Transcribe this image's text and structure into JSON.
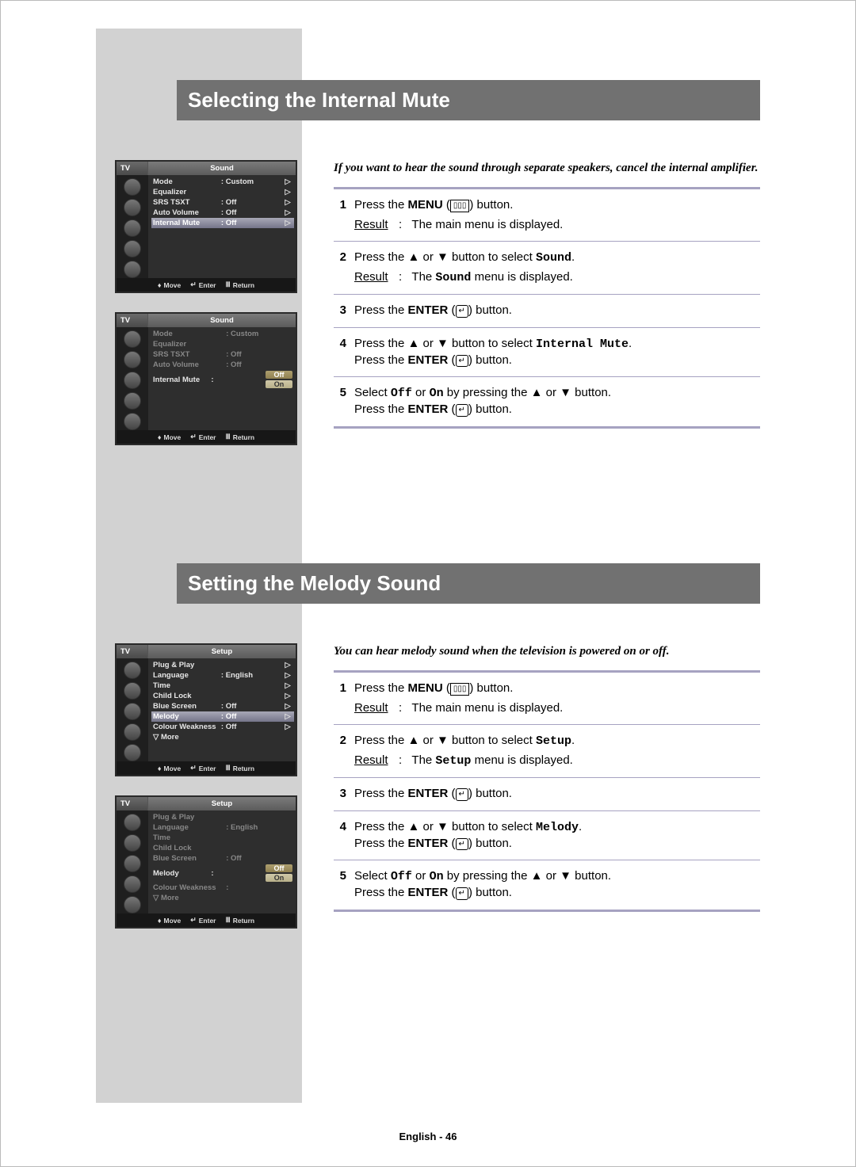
{
  "section1": {
    "title": "Selecting the Internal Mute",
    "intro": "If you want to hear the sound through separate speakers, cancel the internal amplifier.",
    "osd_a": {
      "tv": "TV",
      "title": "Sound",
      "rows": [
        {
          "label": "Mode",
          "value": "Custom"
        },
        {
          "label": "Equalizer",
          "value": ""
        },
        {
          "label": "SRS TSXT",
          "value": "Off"
        },
        {
          "label": "Auto Volume",
          "value": "Off"
        },
        {
          "label": "Internal Mute",
          "value": "Off"
        }
      ],
      "footer": {
        "move": "Move",
        "enter": "Enter",
        "return": "Return"
      }
    },
    "osd_b": {
      "tv": "TV",
      "title": "Sound",
      "rows": [
        {
          "label": "Mode",
          "value": "Custom"
        },
        {
          "label": "Equalizer",
          "value": ""
        },
        {
          "label": "SRS TSXT",
          "value": "Off"
        },
        {
          "label": "Auto Volume",
          "value": "Off"
        },
        {
          "label": "Internal Mute",
          "value": ""
        }
      ],
      "popup": {
        "options": [
          "Off",
          "On"
        ],
        "selected": "Off"
      },
      "footer": {
        "move": "Move",
        "enter": "Enter",
        "return": "Return"
      }
    },
    "steps": [
      {
        "num": "1",
        "main_a": "Press the ",
        "bold": "MENU",
        "main_b": " (",
        "icon": "▯▯▯",
        "main_c": ") button.",
        "result_label": "Result",
        "result": "The main menu is displayed."
      },
      {
        "num": "2",
        "main_a": "Press the ▲ or ▼ button to select ",
        "mono": "Sound",
        "main_b": ".",
        "result_label": "Result",
        "result_pre": "The ",
        "result_mono": "Sound",
        "result_post": " menu is displayed."
      },
      {
        "num": "3",
        "main_a": "Press the ",
        "bold": "ENTER",
        "main_b": " (",
        "icon": "↵",
        "main_c": ") button."
      },
      {
        "num": "4",
        "main_a": "Press the ▲ or ▼ button to select ",
        "mono": "Internal Mute",
        "main_b": ".",
        "line2_a": "Press the ",
        "line2_bold": "ENTER",
        "line2_b": " (",
        "line2_icon": "↵",
        "line2_c": ") button."
      },
      {
        "num": "5",
        "main_a": "Select ",
        "mono1": "Off",
        "main_b": " or ",
        "mono2": "On",
        "main_c": " by pressing the ▲ or ▼ button.",
        "line2_a": "Press the ",
        "line2_bold": "ENTER",
        "line2_b": " (",
        "line2_icon": "↵",
        "line2_c": ") button."
      }
    ]
  },
  "section2": {
    "title": "Setting the Melody Sound",
    "intro": "You can hear melody sound when the television is powered on or off.",
    "osd_a": {
      "tv": "TV",
      "title": "Setup",
      "rows": [
        {
          "label": "Plug & Play",
          "value": ""
        },
        {
          "label": "Language",
          "value": "English"
        },
        {
          "label": "Time",
          "value": ""
        },
        {
          "label": "Child Lock",
          "value": ""
        },
        {
          "label": "Blue Screen",
          "value": "Off"
        },
        {
          "label": "Melody",
          "value": "Off"
        },
        {
          "label": "Colour Weakness",
          "value": "Off"
        },
        {
          "label": "▽ More",
          "value": ""
        }
      ],
      "footer": {
        "move": "Move",
        "enter": "Enter",
        "return": "Return"
      }
    },
    "osd_b": {
      "tv": "TV",
      "title": "Setup",
      "rows": [
        {
          "label": "Plug & Play",
          "value": ""
        },
        {
          "label": "Language",
          "value": "English"
        },
        {
          "label": "Time",
          "value": ""
        },
        {
          "label": "Child Lock",
          "value": ""
        },
        {
          "label": "Blue Screen",
          "value": "Off"
        },
        {
          "label": "Melody",
          "value": ""
        },
        {
          "label": "Colour Weakness",
          "value": ""
        },
        {
          "label": "▽ More",
          "value": ""
        }
      ],
      "popup": {
        "options": [
          "Off",
          "On"
        ],
        "selected": "Off"
      },
      "footer": {
        "move": "Move",
        "enter": "Enter",
        "return": "Return"
      }
    },
    "steps": [
      {
        "num": "1",
        "main_a": "Press the ",
        "bold": "MENU",
        "main_b": " (",
        "icon": "▯▯▯",
        "main_c": ") button.",
        "result_label": "Result",
        "result": "The main menu is displayed."
      },
      {
        "num": "2",
        "main_a": "Press the ▲ or ▼ button to select ",
        "mono": "Setup",
        "main_b": ".",
        "result_label": "Result",
        "result_pre": "The ",
        "result_mono": "Setup",
        "result_post": " menu is displayed."
      },
      {
        "num": "3",
        "main_a": "Press the ",
        "bold": "ENTER",
        "main_b": " (",
        "icon": "↵",
        "main_c": ") button."
      },
      {
        "num": "4",
        "main_a": "Press the ▲ or ▼ button to select ",
        "mono": "Melody",
        "main_b": ".",
        "line2_a": "Press the ",
        "line2_bold": "ENTER",
        "line2_b": " (",
        "line2_icon": "↵",
        "line2_c": ") button."
      },
      {
        "num": "5",
        "main_a": "Select ",
        "mono1": "Off",
        "main_b": " or ",
        "mono2": "On",
        "main_c": " by pressing the ▲ or ▼ button.",
        "line2_a": "Press the ",
        "line2_bold": "ENTER",
        "line2_b": " (",
        "line2_icon": "↵",
        "line2_c": ") button."
      }
    ]
  },
  "page_number": "English - 46"
}
